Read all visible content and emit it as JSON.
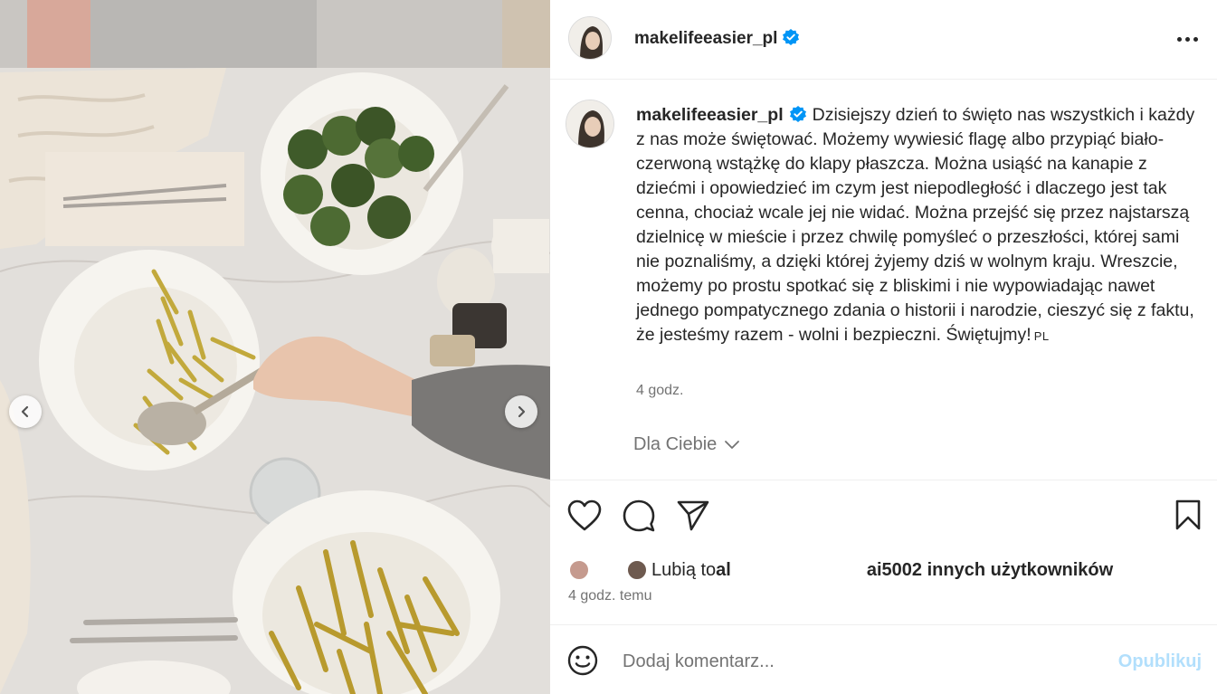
{
  "photo": {
    "alt_icon_prev": "chevron-left-icon",
    "alt_icon_next": "chevron-right-icon"
  },
  "post": {
    "username": "makelifeeasier_pl",
    "verified": true,
    "more_icon": "more-horizontal-icon"
  },
  "caption": {
    "username": "makelifeeasier_pl",
    "text": "Dzisiejszy dzień to święto nas wszystkich i każdy z nas może świętować. Możemy wywiesić flagę albo przypiąć biało-czerwoną wstążkę do klapy płaszcza. Można usiąść na kanapie z dziećmi i opowiedzieć im czym jest niepodległość i dlaczego jest tak cenna, chociaż wcale jej nie widać. Można przejść się przez najstarszą dzielnicę w mieście i przez chwilę pomyśleć o przeszłości, której sami nie poznaliśmy, a dzięki której żyjemy dziś w wolnym kraju. Wreszcie, możemy po prostu spotkać się z bliskimi i nie wypowiadając nawet jednego pompatycznego zdania o historii i narodzie, cieszyć się z faktu, że jesteśmy razem - wolni i bezpieczni. Świętujmy!",
    "lang": "PL",
    "time": "4 godz."
  },
  "for_you": {
    "label": "Dla Ciebie"
  },
  "actions": {
    "like_icon": "heart-icon",
    "comment_icon": "comment-icon",
    "share_icon": "send-icon",
    "save_icon": "bookmark-icon"
  },
  "likes": {
    "prefix": "Lubią to ",
    "user_start": "al",
    "user_end": "a",
    "suffix_connector": " i ",
    "others": "5002 innych użytkowników"
  },
  "post_time": "4 godz. temu",
  "comment": {
    "placeholder": "Dodaj komentarz...",
    "publish_label": "Opublikuj",
    "emoji_icon": "emoji-icon"
  },
  "colors": {
    "verified": "#0095f6",
    "publish_disabled": "#b2dffc",
    "secondary_text": "#737373"
  }
}
